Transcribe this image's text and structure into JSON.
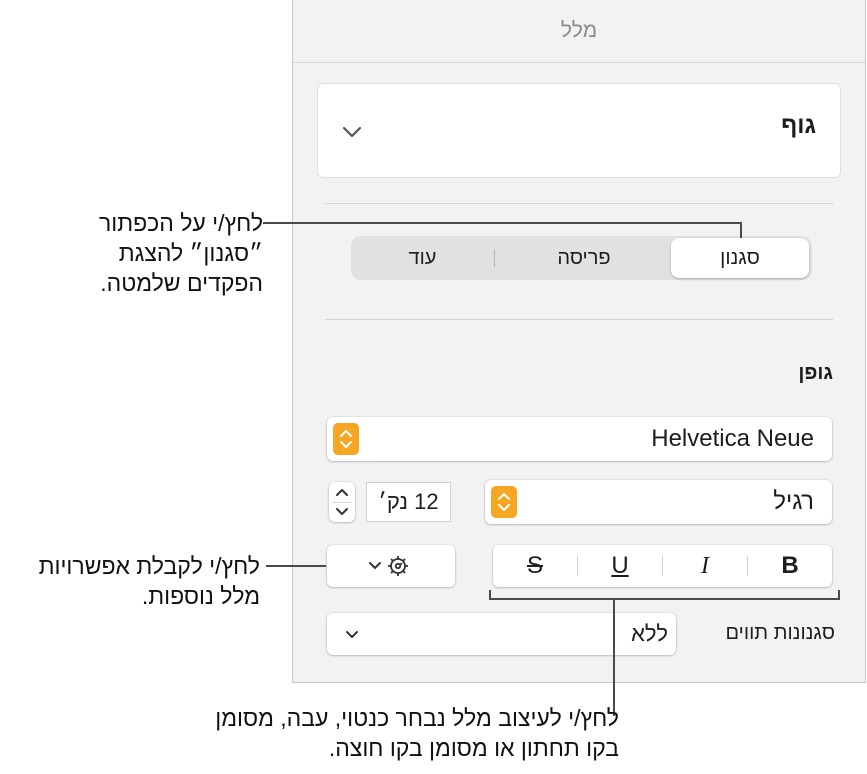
{
  "inspector": {
    "title": "מלל",
    "paragraph_style": "גוף",
    "tabs": [
      {
        "label": "סגנון",
        "active": true
      },
      {
        "label": "פריסה",
        "active": false
      },
      {
        "label": "עוד",
        "active": false
      }
    ],
    "font_section_title": "גופן",
    "font_name": "Helvetica Neue",
    "font_typeface": "רגיל",
    "font_size": "12 נק׳",
    "format_buttons": {
      "bold": "B",
      "italic": "I",
      "underline": "U",
      "strikethrough": "S"
    },
    "character_styles_label": "סגנונות תווים",
    "character_style_value": "ללא",
    "accent_color": "#f5a623"
  },
  "callouts": {
    "style_tab": [
      "לחץ/י על הכפתור",
      "״סגנון״ להצגת",
      "הפקדים שלמטה."
    ],
    "more_options": [
      "לחץ/י לקבלת אפשרויות",
      "מלל נוספות."
    ],
    "format_buttons": [
      "לחץ/י לעיצוב מלל נבחר כנטוי, עבה, מסומן",
      "בקו תחתון או מסומן בקו חוצה."
    ]
  }
}
